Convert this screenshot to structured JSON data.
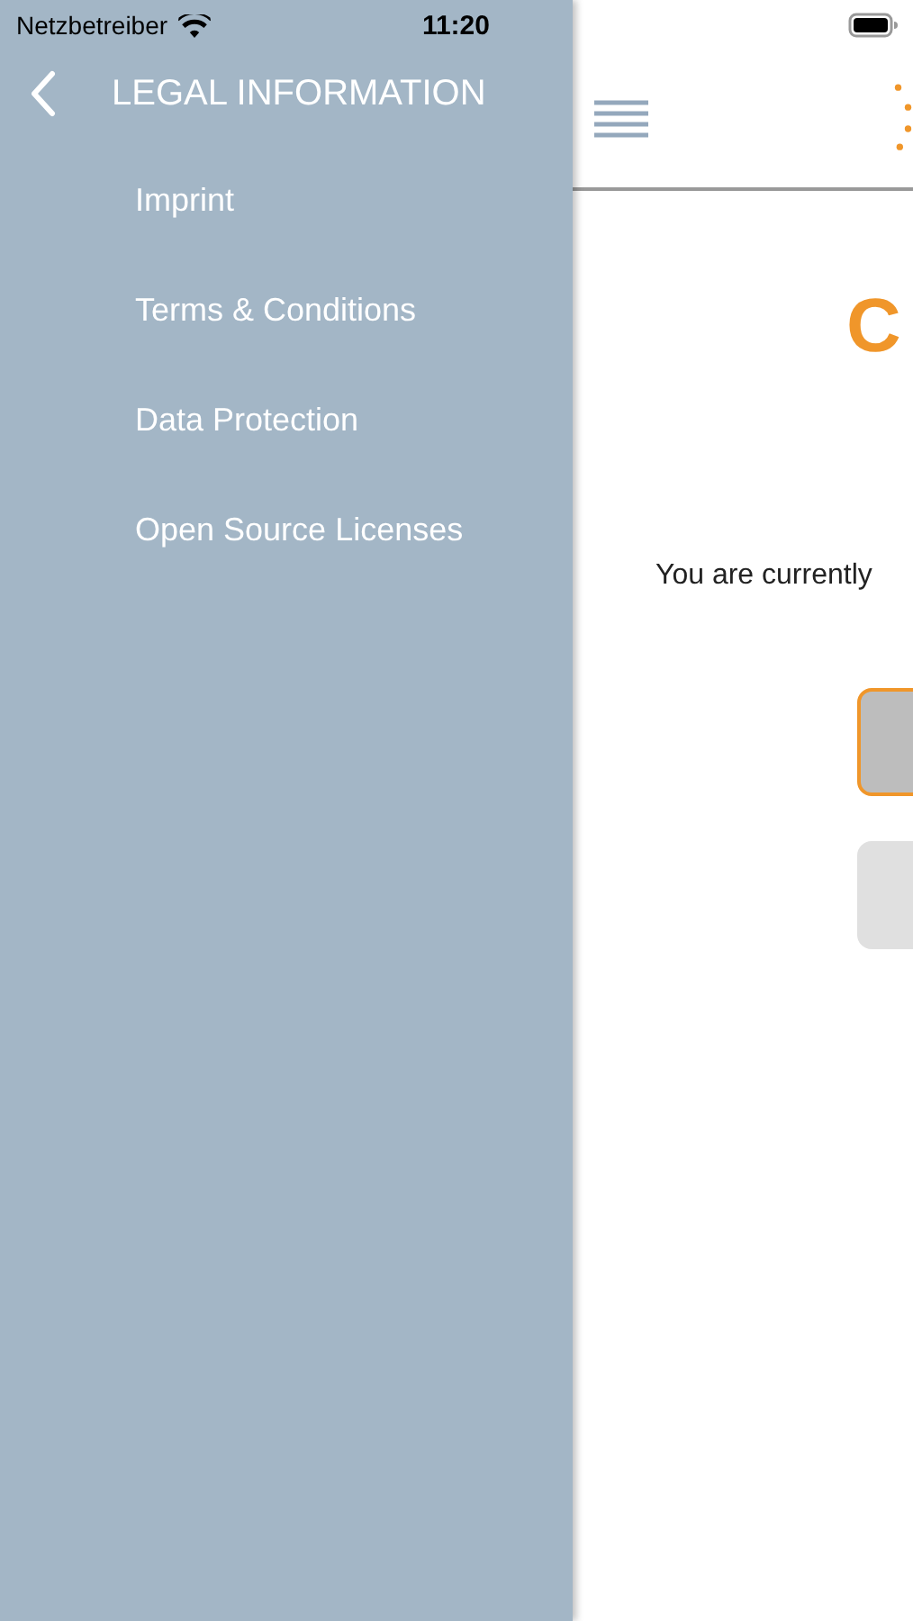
{
  "status_bar": {
    "carrier": "Netzbetreiber",
    "time": "11:20"
  },
  "drawer": {
    "title": "LEGAL INFORMATION",
    "items": [
      {
        "label": "Imprint"
      },
      {
        "label": "Terms & Conditions"
      },
      {
        "label": "Data Protection"
      },
      {
        "label": "Open Source Licenses"
      }
    ]
  },
  "main": {
    "heading": "C",
    "message": "You are currently",
    "buttons": [
      {
        "selected": true
      },
      {
        "selected": false
      }
    ]
  }
}
